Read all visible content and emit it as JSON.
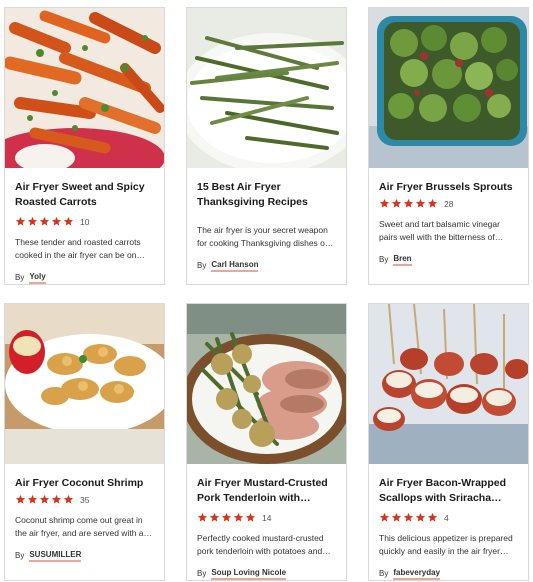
{
  "colors": {
    "star": "#d7331d",
    "card_border": "#d9d9d9",
    "author_underline": "#e8a79b"
  },
  "cards": [
    {
      "title": "Air Fryer Sweet and Spicy Roasted Carrots",
      "stars": 5,
      "rating_count": "10",
      "description": "These tender and roasted carrots cooked in the air fryer can be on your...",
      "by_label": "By",
      "author": "Yoly",
      "image_icon": "roasted-carrots-photo"
    },
    {
      "title": "15 Best Air Fryer Thanksgiving Recipes",
      "stars": 0,
      "rating_count": "",
      "description": "The air fryer is your secret weapon for cooking Thanksgiving dishes on the...",
      "by_label": "By",
      "author": "Carl Hanson",
      "image_icon": "green-beans-photo"
    },
    {
      "title": "Air Fryer Brussels Sprouts",
      "stars": 5,
      "rating_count": "28",
      "description": "Sweet and tart balsamic vinegar pairs well with the bitterness of Brussels...",
      "by_label": "By",
      "author": "Bren",
      "image_icon": "brussels-sprouts-photo"
    },
    {
      "title": "Air Fryer Coconut Shrimp",
      "stars": 5,
      "rating_count": "35",
      "description": "Coconut shrimp come out great in the air fryer, and are served with a simple...",
      "by_label": "By",
      "author": "SUSUMILLER",
      "image_icon": "coconut-shrimp-photo"
    },
    {
      "title": "Air Fryer Mustard-Crusted Pork Tenderloin with Potatoes and Green Beans",
      "stars": 5,
      "rating_count": "14",
      "description": "Perfectly cooked mustard-crusted pork tenderloin with potatoes and green...",
      "by_label": "By",
      "author": "Soup Loving Nicole",
      "image_icon": "pork-tenderloin-photo"
    },
    {
      "title": "Air Fryer Bacon-Wrapped Scallops with Sriracha Mayo",
      "stars": 5,
      "rating_count": "4",
      "description": "This delicious appetizer is prepared quickly and easily in the air fryer and...",
      "by_label": "By",
      "author": "fabeveryday",
      "image_icon": "bacon-scallops-photo"
    }
  ]
}
